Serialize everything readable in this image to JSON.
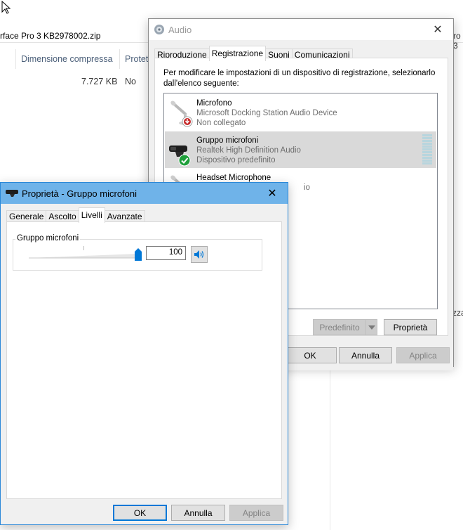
{
  "explorer": {
    "address_text": "rface Pro 3 KB2978002.zip",
    "address_right": "ro 3",
    "columns": [
      "Dimensione compressa",
      "Protet"
    ],
    "row": {
      "size": "7.727 KB",
      "protected": "No"
    },
    "edge_text": "zza"
  },
  "audio_window": {
    "title": "Audio",
    "tabs": [
      "Riproduzione",
      "Registrazione",
      "Suoni",
      "Comunicazioni"
    ],
    "active_tab": "Registrazione",
    "instructions": "Per modificare le impostazioni di un dispositivo di registrazione, selezionarlo dall'elenco seguente:",
    "devices": [
      {
        "name": "Microfono",
        "device": "Microsoft Docking Station Audio Device",
        "status": "Non collegato",
        "icon": "microphone-icon",
        "badge": "disconnected-badge-icon",
        "selected": false
      },
      {
        "name": "Gruppo microfoni",
        "device": "Realtek High Definition Audio",
        "status": "Dispositivo predefinito",
        "icon": "microphone-array-icon",
        "badge": "default-check-icon",
        "selected": true
      },
      {
        "name": "Headset Microphone",
        "device": "io",
        "status": "",
        "icon": "microphone-icon",
        "badge": "",
        "selected": false
      }
    ],
    "buttons": {
      "default": "Predefinito",
      "properties": "Proprietà",
      "ok": "OK",
      "cancel": "Annulla",
      "apply": "Applica"
    }
  },
  "props_window": {
    "title": "Proprietà - Gruppo microfoni",
    "tabs": [
      "Generale",
      "Ascolto",
      "Livelli",
      "Avanzate"
    ],
    "active_tab": "Livelli",
    "group_label": "Gruppo microfoni",
    "level_value": "100",
    "level_fraction": 1.0,
    "buttons": {
      "ok": "OK",
      "cancel": "Annulla",
      "apply": "Applica"
    }
  },
  "colors": {
    "accent": "#0078d7",
    "titlebar_active": "#6fb3e9",
    "selection": "#d9d9d9",
    "check_green": "#1e9f3a",
    "disconnect_red": "#c62828"
  }
}
